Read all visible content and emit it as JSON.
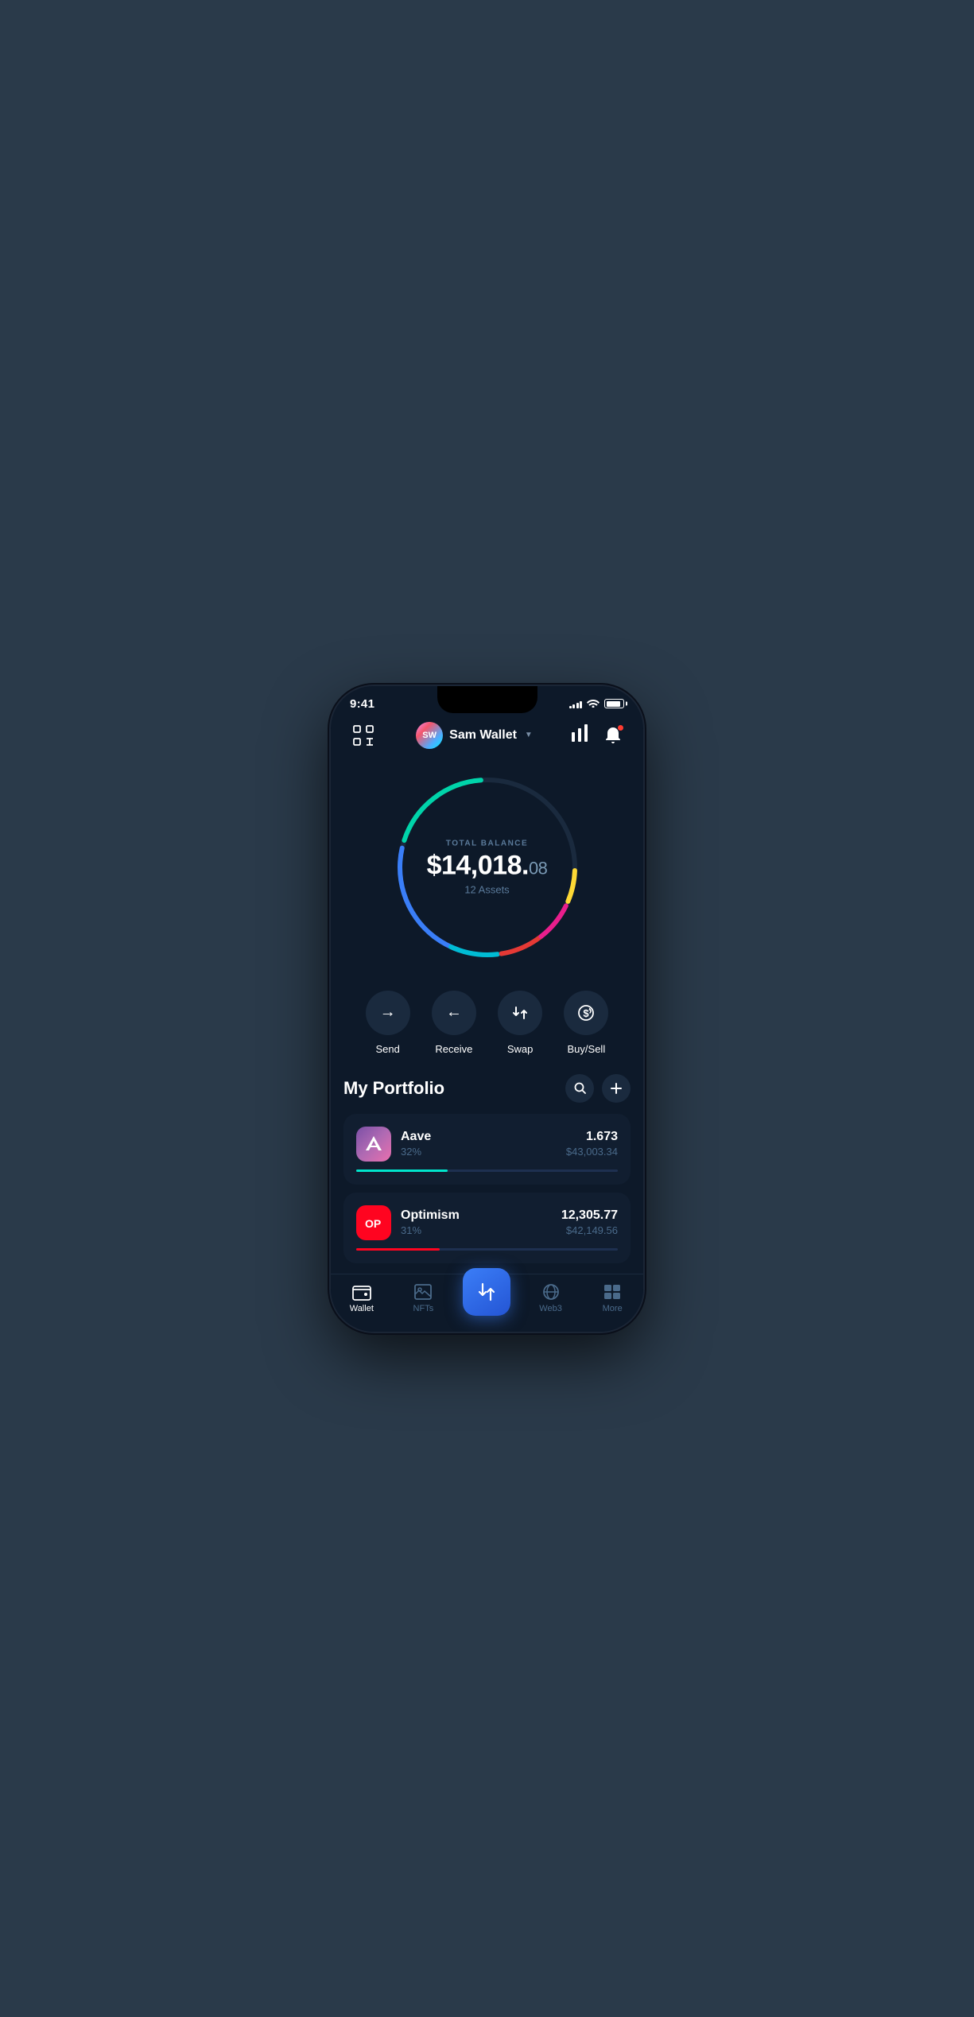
{
  "status": {
    "time": "9:41",
    "signal_bars": [
      3,
      5,
      7,
      9,
      11
    ],
    "battery_pct": 85
  },
  "header": {
    "scan_label": "scan",
    "user": {
      "initials": "SW",
      "name": "Sam Wallet"
    },
    "chart_label": "chart",
    "bell_label": "notifications"
  },
  "balance": {
    "label": "TOTAL BALANCE",
    "whole": "$14,018.",
    "cents": "08",
    "assets_label": "12 Assets"
  },
  "actions": [
    {
      "id": "send",
      "label": "Send",
      "icon": "→"
    },
    {
      "id": "receive",
      "label": "Receive",
      "icon": "←"
    },
    {
      "id": "swap",
      "label": "Swap",
      "icon": "⇅"
    },
    {
      "id": "buysell",
      "label": "Buy/Sell",
      "icon": "💲"
    }
  ],
  "portfolio": {
    "title": "My Portfolio",
    "search_label": "search",
    "add_label": "add",
    "assets": [
      {
        "id": "aave",
        "name": "Aave",
        "pct": "32%",
        "amount": "1.673",
        "usd": "$43,003.34",
        "progress": 35,
        "logo_text": "A"
      },
      {
        "id": "optimism",
        "name": "Optimism",
        "pct": "31%",
        "amount": "12,305.77",
        "usd": "$42,149.56",
        "progress": 32,
        "logo_text": "OP"
      }
    ]
  },
  "bottom_nav": [
    {
      "id": "wallet",
      "label": "Wallet",
      "active": true
    },
    {
      "id": "nfts",
      "label": "NFTs",
      "active": false
    },
    {
      "id": "swap_center",
      "label": "",
      "active": false,
      "is_center": true
    },
    {
      "id": "web3",
      "label": "Web3",
      "active": false
    },
    {
      "id": "more",
      "label": "More",
      "active": false
    }
  ]
}
